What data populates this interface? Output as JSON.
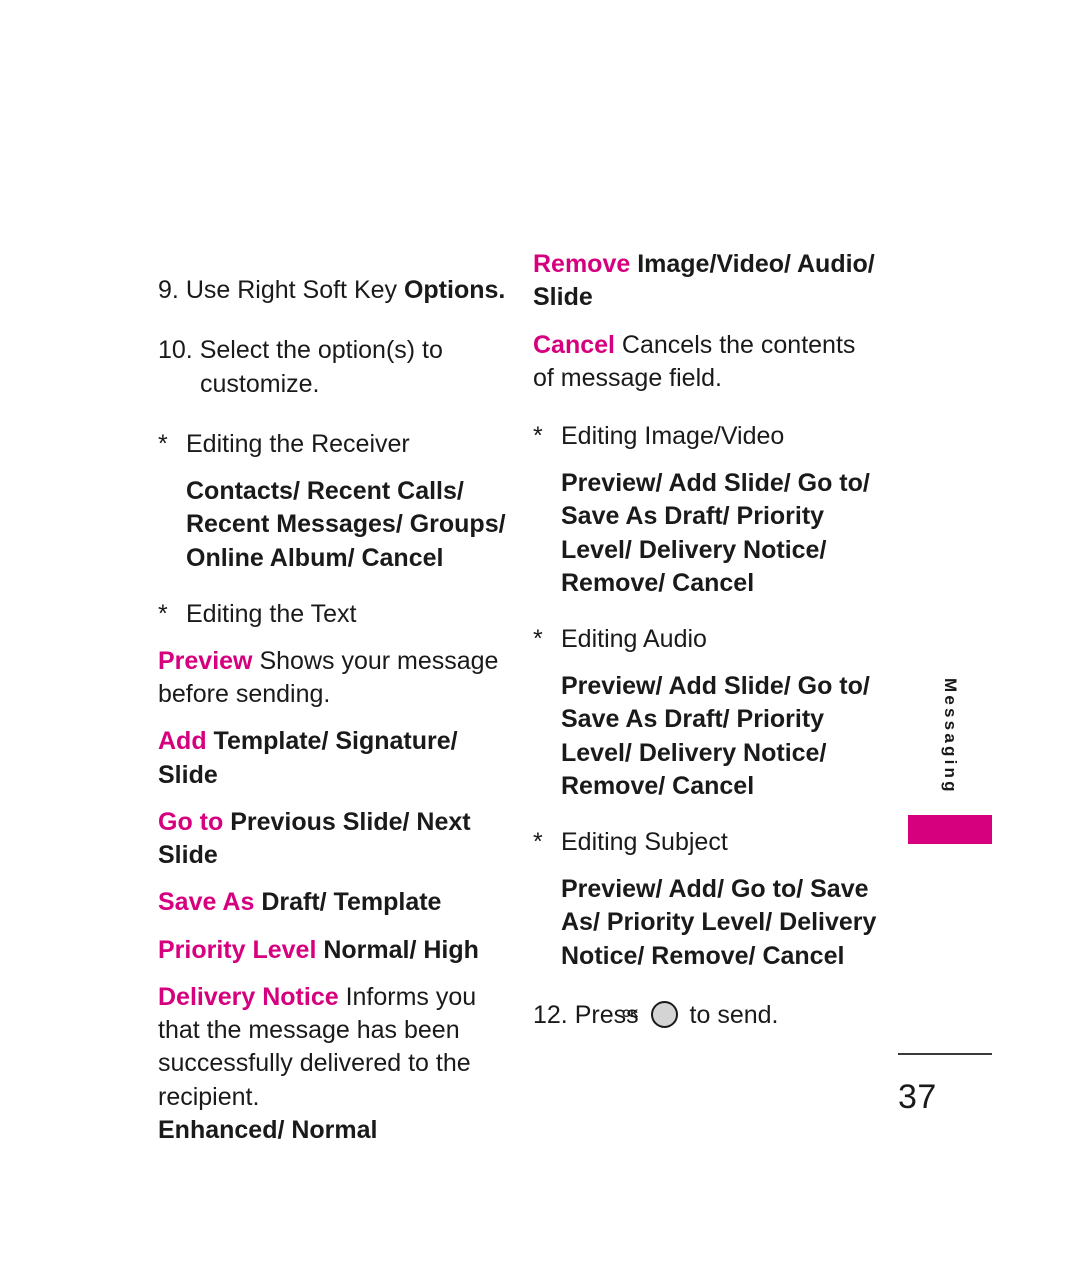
{
  "accent_color": "#d6007f",
  "text_color": "#1a1a1a",
  "left_column": {
    "step9": {
      "num": "9.",
      "text": "Use Right Soft Key ",
      "emphasis": "Options."
    },
    "step10": {
      "num": "10.",
      "text": "Select the option(s) to customize."
    },
    "heading_receiver": {
      "star": "*",
      "label": "Editing the Receiver"
    },
    "receiver_options": "Contacts/ Recent Calls/ Recent Messages/ Groups/ Online Album/ Cancel",
    "heading_text": {
      "star": "*",
      "label": "Editing the Text"
    },
    "def_preview": {
      "term": "Preview",
      "body": " Shows your message before sending."
    },
    "def_add": {
      "term": "Add",
      "body": " Template/ Signature/ Slide"
    },
    "def_goto": {
      "term": "Go to",
      "body": " Previous Slide/ Next Slide"
    },
    "def_saveas": {
      "term": "Save As",
      "body": " Draft/ Template"
    },
    "def_priority": {
      "term": "Priority Level",
      "body": " Normal/ High"
    },
    "def_delivery": {
      "term": "Delivery Notice",
      "body": " Informs you that the message has been successfully delivered to the recipient."
    },
    "delivery_values": "Enhanced/ Normal"
  },
  "right_column": {
    "def_remove": {
      "term": "Remove",
      "body": " Image/Video/ Audio/ Slide"
    },
    "def_cancel": {
      "term": "Cancel",
      "body": " Cancels the contents of message field."
    },
    "heading_image_video": {
      "star": "*",
      "label": "Editing Image/Video"
    },
    "image_video_options": "Preview/ Add Slide/ Go to/ Save As Draft/ Priority Level/ Delivery Notice/ Remove/ Cancel",
    "heading_audio": {
      "star": "*",
      "label": "Editing Audio"
    },
    "audio_options": "Preview/ Add Slide/ Go to/ Save As Draft/ Priority Level/ Delivery Notice/ Remove/ Cancel",
    "heading_subject": {
      "star": "*",
      "label": "Editing Subject"
    },
    "subject_options": "Preview/ Add/ Go to/ Save As/ Priority Level/ Delivery Notice/ Remove/ Cancel",
    "step12": {
      "num": "12.",
      "before": "Press ",
      "key_label": "OK",
      "after": " to send."
    }
  },
  "margin_tab": {
    "label": "Messaging"
  },
  "footer": {
    "page_number": "37"
  }
}
